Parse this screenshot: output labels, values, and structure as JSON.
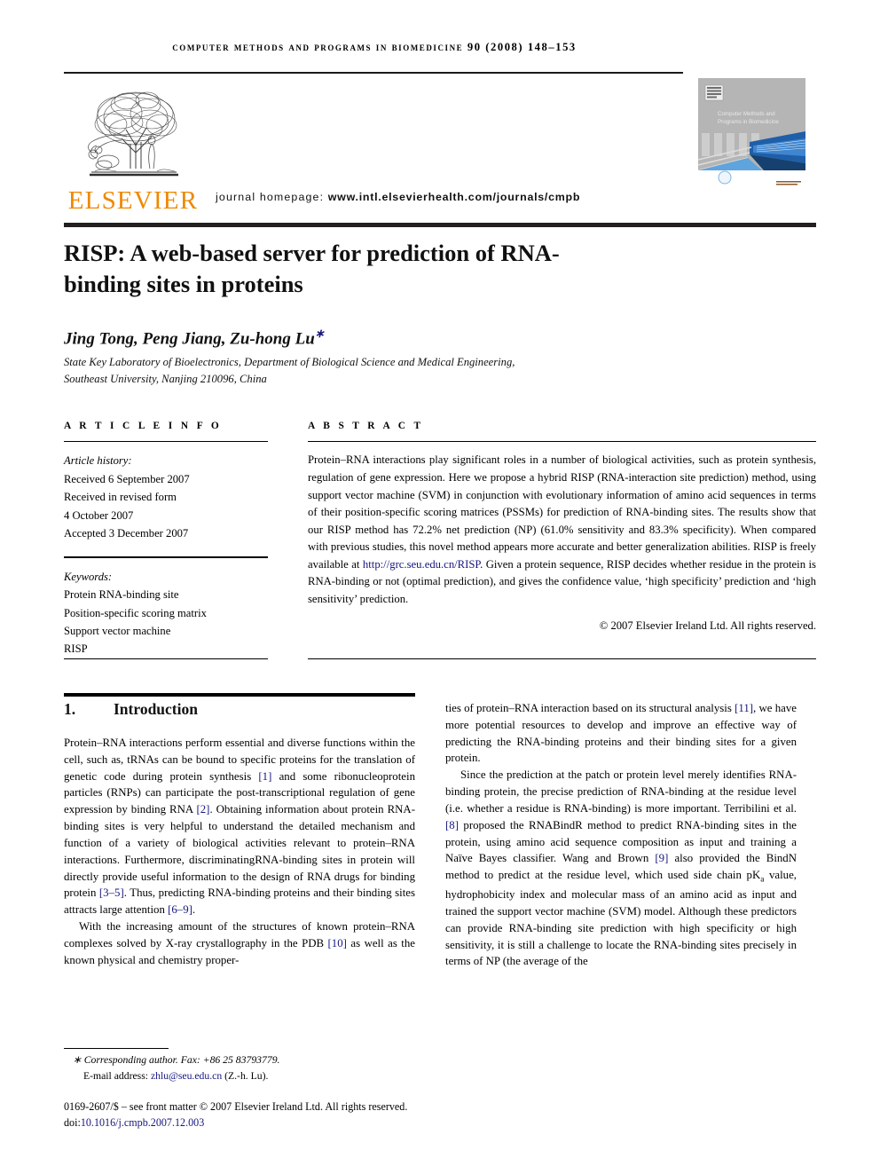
{
  "masthead": {
    "journal_header": "computer methods and programs in biomedicine 90 (2008) 148–153",
    "publisher_name": "ELSEVIER",
    "homepage_label": "journal homepage:",
    "homepage_url": "www.intl.elsevierhealth.com/journals/cmpb",
    "cover_title_line1": "Computer Methods and",
    "cover_title_line2": "Programs in Biomedicine"
  },
  "article": {
    "title": "RISP: A web-based server for prediction of RNA-binding sites in proteins",
    "authors": "Jing Tong, Peng Jiang, Zu-hong Lu",
    "corresponding_marker": "∗",
    "affiliation_line1": "State Key Laboratory of Bioelectronics, Department of Biological Science and Medical Engineering,",
    "affiliation_line2": "Southeast University, Nanjing 210096, China"
  },
  "info": {
    "heading": "A R T I C L E   I N F O",
    "history_label": "Article history:",
    "history": [
      "Received 6 September 2007",
      "Received in revised form",
      "4 October 2007",
      "Accepted 3 December 2007"
    ],
    "keywords_label": "Keywords:",
    "keywords": [
      "Protein RNA-binding site",
      "Position-specific scoring matrix",
      "Support vector machine",
      "RISP"
    ]
  },
  "abstract": {
    "heading": "A B S T R A C T",
    "part1": "Protein–RNA interactions play significant roles in a number of biological activities, such as protein synthesis, regulation of gene expression. Here we propose a hybrid RISP (RNA-interaction site prediction) method, using support vector machine (SVM) in conjunction with evolutionary information of amino acid sequences in terms of their position-specific scoring matrices (PSSMs) for prediction of RNA-binding sites. The results show that our RISP method has 72.2% net prediction (NP) (61.0% sensitivity and 83.3% specificity). When compared with previous studies, this novel method appears more accurate and better generalization abilities. RISP is freely available at ",
    "link_text": "http://grc.seu.edu.cn/RISP",
    "part2": ". Given a protein sequence, RISP decides whether residue in the protein is RNA-binding or not (optimal prediction), and gives the confidence value, ‘high specificity’ prediction and ‘high sensitivity’ prediction.",
    "copyright": "© 2007 Elsevier Ireland Ltd. All rights reserved."
  },
  "introduction": {
    "number": "1.",
    "heading": "Introduction",
    "left_p1_a": "Protein–RNA interactions perform essential and diverse functions within the cell, such as, tRNAs can be bound to specific proteins for the translation of genetic code during protein synthesis ",
    "ref1": "[1]",
    "left_p1_b": " and some ribonucleoprotein particles (RNPs) can participate the post-transcriptional regulation of gene expression by binding RNA ",
    "ref2": "[2]",
    "left_p1_c": ". Obtaining information about protein RNA-binding sites is very helpful to understand the detailed mechanism and function of a variety of biological activities relevant to protein–RNA interactions. Furthermore, discriminatingRNA-binding sites in protein will directly provide useful information to the design of RNA drugs for binding protein ",
    "ref3": "[3–5]",
    "left_p1_d": ". Thus, predicting RNA-binding proteins and their binding sites attracts large attention ",
    "ref4": "[6–9]",
    "left_p1_e": ".",
    "left_p2_a": "With the increasing amount of the structures of known protein–RNA complexes solved by X-ray crystallography in the PDB ",
    "ref5": "[10]",
    "left_p2_b": " as well as the known physical and chemistry proper-",
    "right_p1_a": "ties of protein–RNA interaction based on its structural analysis ",
    "ref6": "[11]",
    "right_p1_b": ", we have more potential resources to develop and improve an effective way of predicting the RNA-binding proteins and their binding sites for a given protein.",
    "right_p2_a": "Since the prediction at the patch or protein level merely identifies RNA-binding protein, the precise prediction of RNA-binding at the residue level (i.e. whether a residue is RNA-binding) is more important. Terribilini et al. ",
    "ref7": "[8]",
    "right_p2_b": " proposed the RNABindR method to predict RNA-binding sites in the protein, using amino acid sequence composition as input and training a Naïve Bayes classifier. Wang and Brown ",
    "ref8": "[9]",
    "right_p2_c": " also provided the BindN method to predict at the residue level, which used side chain pK",
    "right_p2_sub": "a",
    "right_p2_d": " value, hydrophobicity index and molecular mass of an amino acid as input and trained the support vector machine (SVM) model. Although these predictors can provide RNA-binding site prediction with high specificity or high sensitivity, it is still a challenge to locate the RNA-binding sites precisely in terms of NP (the average of the"
  },
  "footer": {
    "corresponding_marker": "∗",
    "corresponding_text": "Corresponding author. Fax: +86 25 83793779.",
    "email_label": "E-mail address:",
    "email": "zhlu@seu.edu.cn",
    "email_suffix": "(Z.-h. Lu).",
    "legal_a": "0169-2607/$ – see front matter © 2007 Elsevier Ireland Ltd. All rights reserved.",
    "doi_label": "doi:",
    "doi": "10.1016/j.cmpb.2007.12.003"
  },
  "colors": {
    "link_blue": "#16167f",
    "elsevier_orange": "#EE8800",
    "rule_dark": "#231f20"
  }
}
